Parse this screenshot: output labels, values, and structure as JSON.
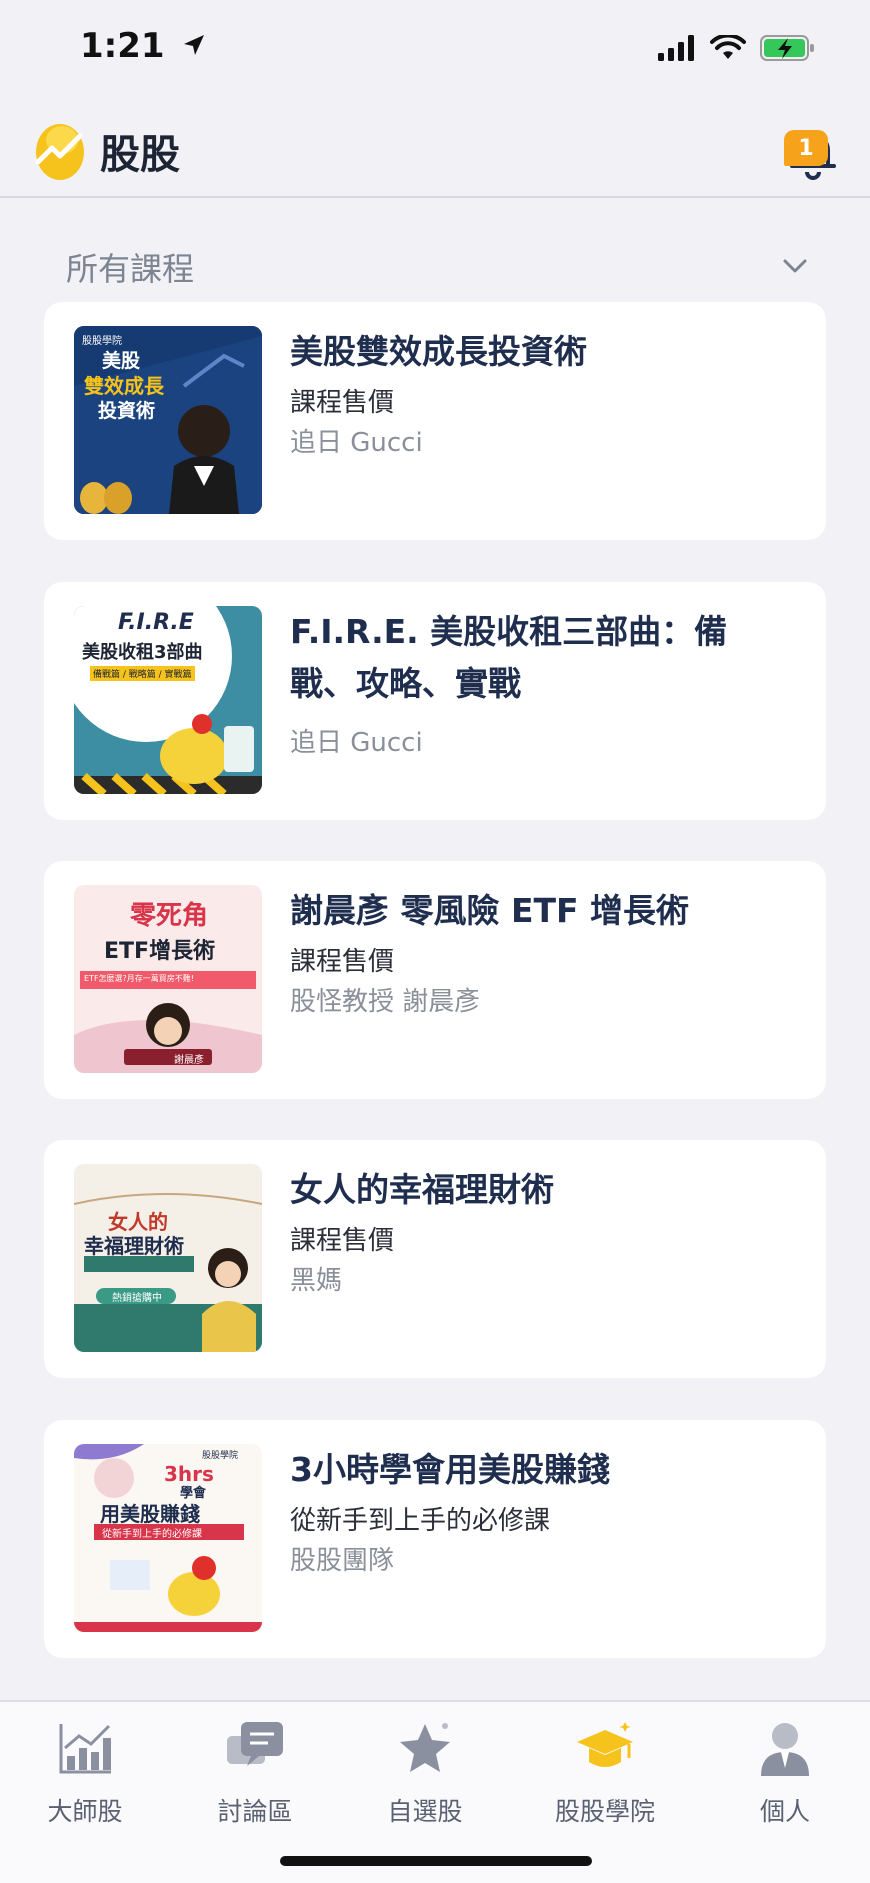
{
  "status_bar": {
    "time": "1:21"
  },
  "header": {
    "app_name": "股股",
    "notification_count": "1"
  },
  "section": {
    "title": "所有課程"
  },
  "courses": [
    {
      "title": "美股雙效成長投資術",
      "line2": "課程售價",
      "author": "追日 Gucci",
      "thumb_text": [
        "股股學院",
        "美股",
        "雙效成長",
        "投資術"
      ]
    },
    {
      "title": "F.I.R.E. 美股收租三部曲：備戰、攻略、實戰",
      "line2": "",
      "author": "追日 Gucci",
      "thumb_text": [
        "F.I.R.E",
        "美股收租3部曲",
        "備戰篇 / 戰略篇 / 實戰篇"
      ]
    },
    {
      "title": "謝晨彥 零風險 ETF 增長術",
      "line2": "課程售價",
      "author": "股怪教授 謝晨彥",
      "thumb_text": [
        "零死角",
        "ETF增長術",
        "ETF怎麼選?月存一萬買房不難!",
        "謝晨彥"
      ]
    },
    {
      "title": "女人的幸福理財術",
      "line2": "課程售價",
      "author": "黑媽",
      "thumb_text": [
        "女人的",
        "幸福理財術",
        "熱銷搶購中"
      ]
    },
    {
      "title": "3小時學會用美股賺錢",
      "line2": "從新手到上手的必修課",
      "author": "股股團隊",
      "thumb_text": [
        "股股學院",
        "3hrs",
        "學會",
        "用美股賺錢",
        "從新手到上手的必修課"
      ]
    }
  ],
  "tabs": [
    {
      "label": "大師股",
      "icon": "chart-icon"
    },
    {
      "label": "討論區",
      "icon": "chat-icon"
    },
    {
      "label": "自選股",
      "icon": "star-icon"
    },
    {
      "label": "股股學院",
      "icon": "graduation-cap-icon",
      "active": true
    },
    {
      "label": "個人",
      "icon": "person-icon"
    }
  ],
  "colors": {
    "accent": "#f7a21b",
    "title": "#1f2d4e",
    "background": "#f1f1f6"
  }
}
